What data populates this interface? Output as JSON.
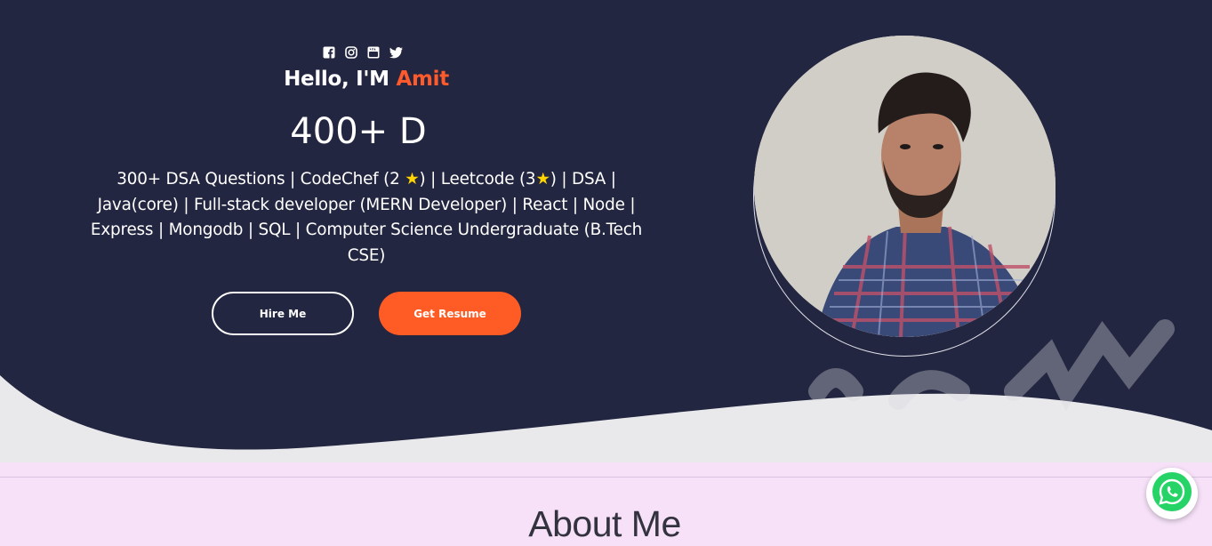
{
  "hero": {
    "social_icons": [
      "facebook-icon",
      "instagram-icon",
      "youtube-icon",
      "twitter-icon"
    ],
    "greeting_prefix": "Hello, I'M ",
    "greeting_name": "Amit",
    "typed_text": "400+ D",
    "bio_parts": [
      "300+ DSA Questions | CodeChef (2 ",
      "★",
      ") | Leetcode (3",
      "★",
      ") | DSA | Java(core) | Full-stack developer (MERN Developer) | React | Node | Express | Mongodb | SQL | Computer Science Undergraduate (B.Tech CSE)"
    ],
    "buttons": {
      "hire": "Hire Me",
      "resume": "Get Resume"
    }
  },
  "about": {
    "title": "About Me"
  },
  "floating": {
    "whatsapp_icon": "whatsapp-icon"
  },
  "colors": {
    "navy": "#232640",
    "accent": "#ff5b25",
    "section_bg": "#f6e1f8",
    "whatsapp_green": "#25d366"
  }
}
